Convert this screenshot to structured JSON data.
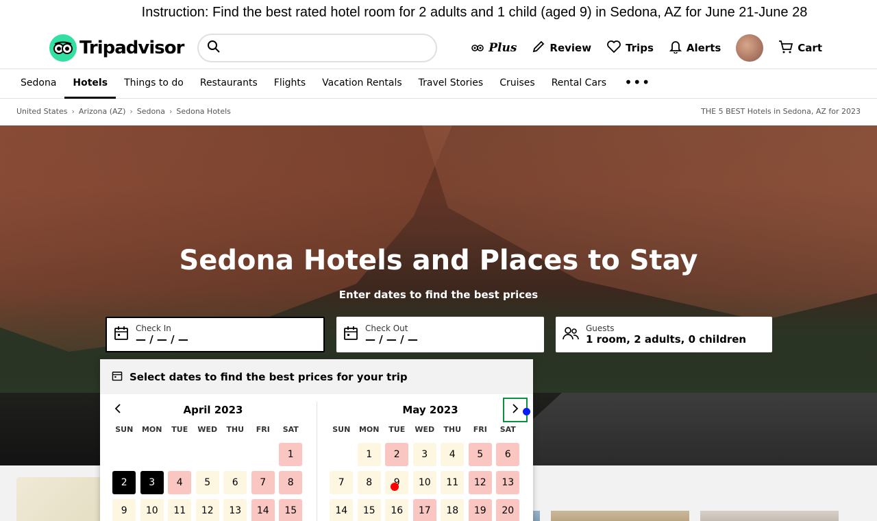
{
  "instruction": "Instruction: Find the best rated hotel room for 2 adults and 1 child (aged 9) in Sedona, AZ for June 21-June 28",
  "header": {
    "logo_text": "Tripadvisor",
    "search_placeholder": "",
    "plus_label": "Plus",
    "review_label": "Review",
    "trips_label": "Trips",
    "alerts_label": "Alerts",
    "cart_label": "Cart"
  },
  "subnav": {
    "tabs": [
      "Sedona",
      "Hotels",
      "Things to do",
      "Restaurants",
      "Flights",
      "Vacation Rentals",
      "Travel Stories",
      "Cruises",
      "Rental Cars"
    ],
    "active_tab": "Hotels",
    "more": "•••"
  },
  "breadcrumb": {
    "items": [
      "United States",
      "Arizona (AZ)",
      "Sedona",
      "Sedona Hotels"
    ],
    "right_text": "THE 5 BEST Hotels in Sedona, AZ for 2023"
  },
  "hero": {
    "title": "Sedona Hotels and Places to Stay",
    "subtitle": "Enter dates to find the best prices"
  },
  "search_form": {
    "check_in_label": "Check In",
    "check_in_value": "— / — / —",
    "check_out_label": "Check Out",
    "check_out_value": "— / — / —",
    "guests_label": "Guests",
    "guests_value": "1 room, 2 adults, 0 children"
  },
  "calendar": {
    "header": "Select dates to find the best prices for your trip",
    "weekdays": [
      "SUN",
      "MON",
      "TUE",
      "WED",
      "THU",
      "FRI",
      "SAT"
    ],
    "months": [
      {
        "title": "April 2023",
        "days": [
          [
            "",
            "",
            "",
            "",
            "",
            "",
            "1"
          ],
          [
            "2",
            "3",
            "4",
            "5",
            "6",
            "7",
            "8"
          ],
          [
            "9",
            "10",
            "11",
            "12",
            "13",
            "14",
            "15"
          ]
        ],
        "styles": [
          [
            "empty",
            "empty",
            "empty",
            "empty",
            "empty",
            "empty",
            "high"
          ],
          [
            "sel",
            "sel",
            "high",
            "low",
            "low",
            "high",
            "high"
          ],
          [
            "low",
            "low",
            "low",
            "low",
            "low",
            "high",
            "high"
          ]
        ]
      },
      {
        "title": "May 2023",
        "days": [
          [
            "",
            "1",
            "2",
            "3",
            "4",
            "5",
            "6"
          ],
          [
            "7",
            "8",
            "9",
            "10",
            "11",
            "12",
            "13"
          ],
          [
            "14",
            "15",
            "16",
            "17",
            "18",
            "19",
            "20"
          ]
        ],
        "styles": [
          [
            "empty",
            "low",
            "high",
            "low",
            "low",
            "high",
            "high"
          ],
          [
            "low",
            "low",
            "low",
            "low",
            "low",
            "high",
            "high"
          ],
          [
            "low",
            "low",
            "low",
            "high",
            "low",
            "high",
            "high"
          ]
        ]
      }
    ]
  },
  "colors": {
    "brand_green": "#34e0a1",
    "price_low": "#fdf6e0",
    "price_high": "#f9c6c2",
    "selected": "#000000",
    "focus_border": "#0a8f3c"
  }
}
